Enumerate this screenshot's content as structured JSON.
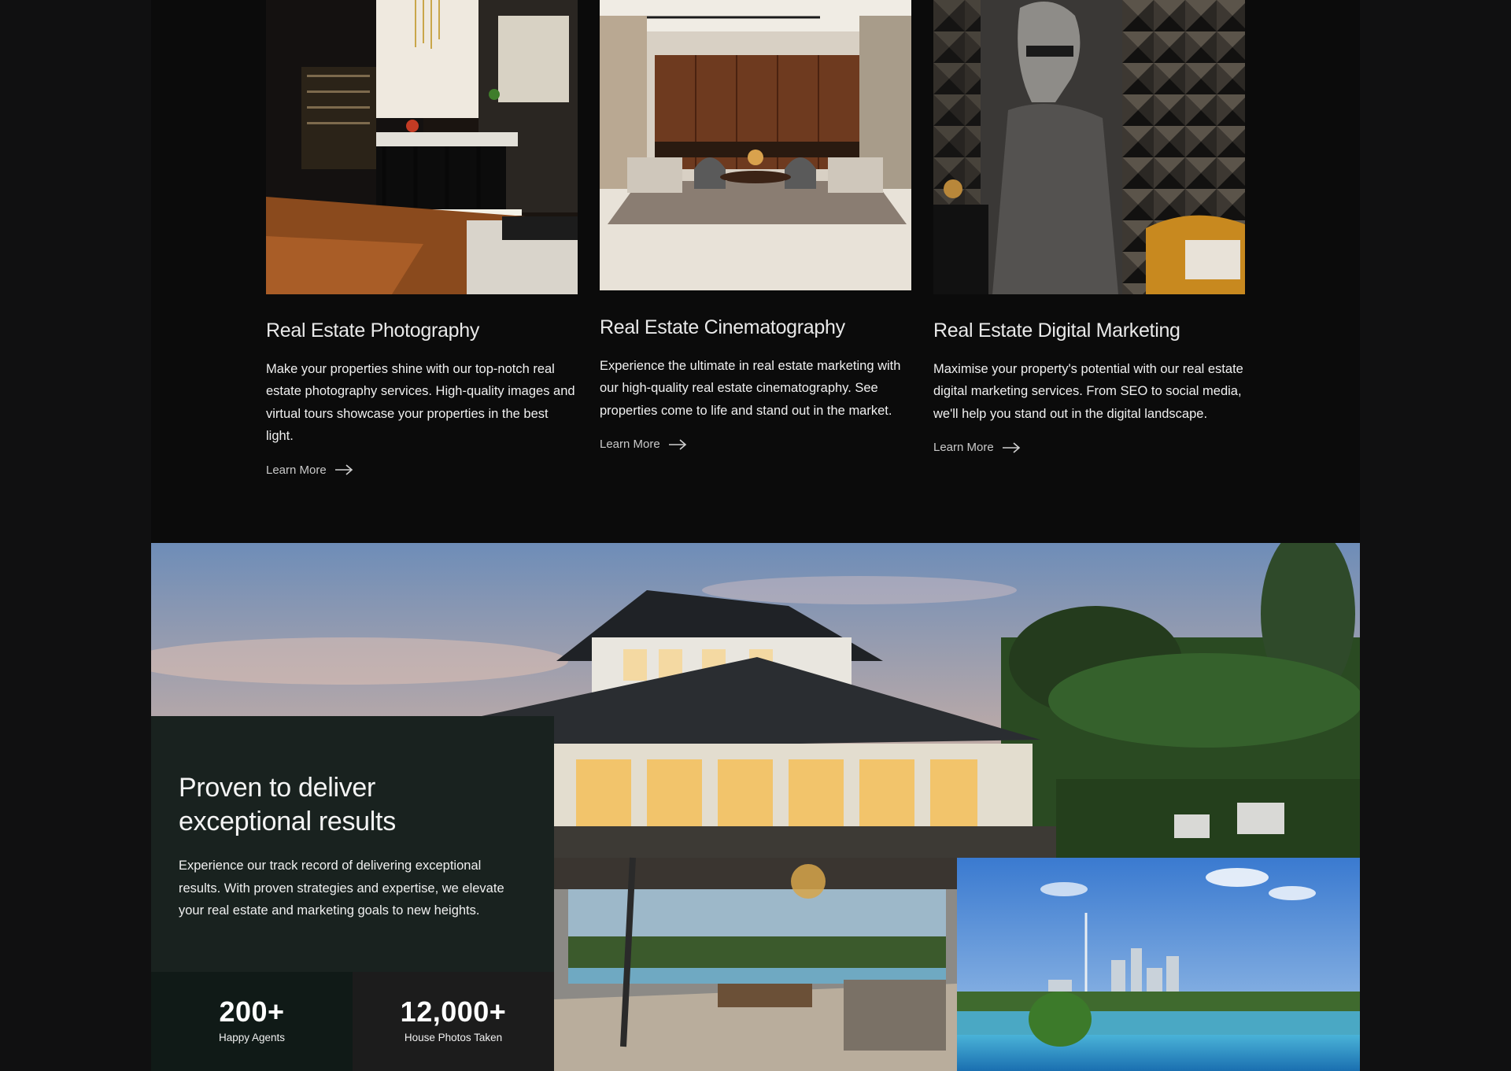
{
  "services": [
    {
      "title": "Real Estate Photography",
      "description": "Make your properties shine with our top-notch real estate photography services. High-quality images and virtual tours showcase your properties in the best light.",
      "link_label": "Learn More"
    },
    {
      "title": "Real Estate Cinematography",
      "description": "Experience the ultimate in real estate marketing with our high-quality real estate cinematography.  See properties come to life and stand out in the market.",
      "link_label": "Learn More"
    },
    {
      "title": "Real Estate Digital Marketing",
      "description": "Maximise your property's potential with our real estate digital marketing services. From SEO to social media, we'll help you stand out in the digital landscape.",
      "link_label": "Learn More"
    }
  ],
  "results": {
    "heading": "Proven to deliver exceptional results",
    "description": "Experience our track record of delivering exceptional results. With proven strategies and expertise, we elevate your real estate and marketing goals to new heights.",
    "stats": [
      {
        "value": "200+",
        "label": "Happy Agents"
      },
      {
        "value": "12,000+",
        "label": "House Photos Taken"
      }
    ]
  },
  "icons": {
    "link_arrow": "arrow-right-icon"
  },
  "colors": {
    "page_background": "#0b0b0b",
    "panel_background": "#19221f",
    "stat_dark": "#101a17",
    "stat_grey": "#1c1c1c"
  }
}
